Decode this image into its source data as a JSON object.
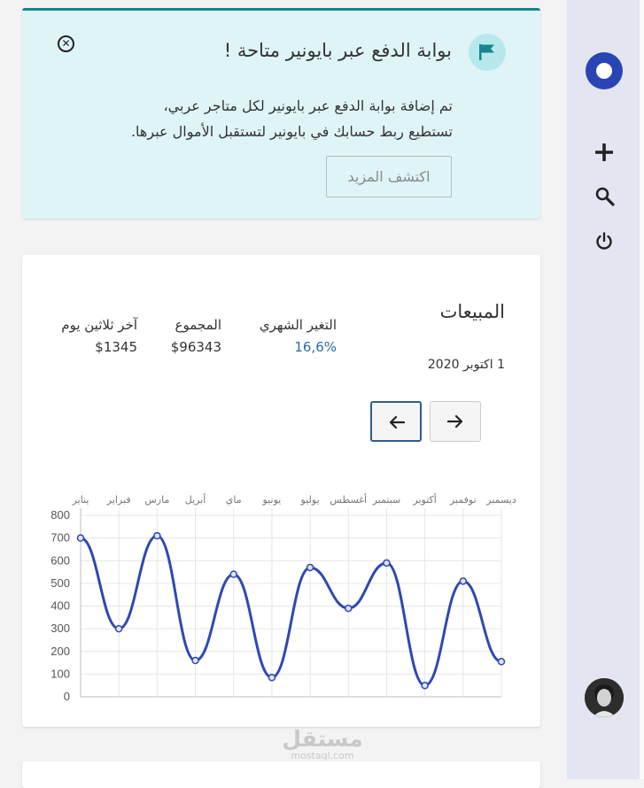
{
  "alert": {
    "title": "بوابة الدفع عبر بايونير متاحة !",
    "body_line1": "تم إضافة بوابة الدفع عبر بايونير لكل متاجر عربي،",
    "body_line2": "تستطيع ربط حسابك في بايونير لتستقبل الأموال عبرها.",
    "button_label": "اكتشف المزيد",
    "close_icon": "circle-x-icon",
    "flag_icon": "flag-icon"
  },
  "sales": {
    "title": "المبيعات",
    "date": "1 اكتوبر 2020",
    "monthly_change_label": "التغير الشهري",
    "monthly_change_value": "16,6%",
    "total_label": "المجموع",
    "total_value": "$96343",
    "last30_label": "آخر ثلاثين يوم",
    "last30_value": "$1345",
    "prev_icon": "arrow-left-icon",
    "next_icon": "arrow-right-icon"
  },
  "chart_data": {
    "type": "line",
    "categories": [
      "يناير",
      "فبراير",
      "مارس",
      "أبريل",
      "ماي",
      "يونيو",
      "يوليو",
      "أغسطس",
      "سبتمبر",
      "أكتوبر",
      "نوفمبر",
      "ديسمبر"
    ],
    "values": [
      700,
      300,
      710,
      160,
      540,
      85,
      570,
      390,
      590,
      50,
      510,
      155
    ],
    "ylim": [
      0,
      800
    ],
    "yticks": [
      0,
      100,
      200,
      300,
      400,
      500,
      600,
      700,
      800
    ],
    "grid": true,
    "color": "#2f48b3",
    "smooth": true
  },
  "rail": {
    "logo_icon": "logo-circle-icon",
    "add_icon": "plus-icon",
    "search_icon": "search-icon",
    "power_icon": "power-icon",
    "avatar": "user-avatar"
  },
  "watermark": {
    "arabic": "مستقل",
    "latin": "mostaql.com"
  },
  "colors": {
    "accent": "#2f48b3",
    "alert_bg": "#dff4f7",
    "alert_border": "#16868f",
    "rail_bg": "#e3e5f1"
  }
}
